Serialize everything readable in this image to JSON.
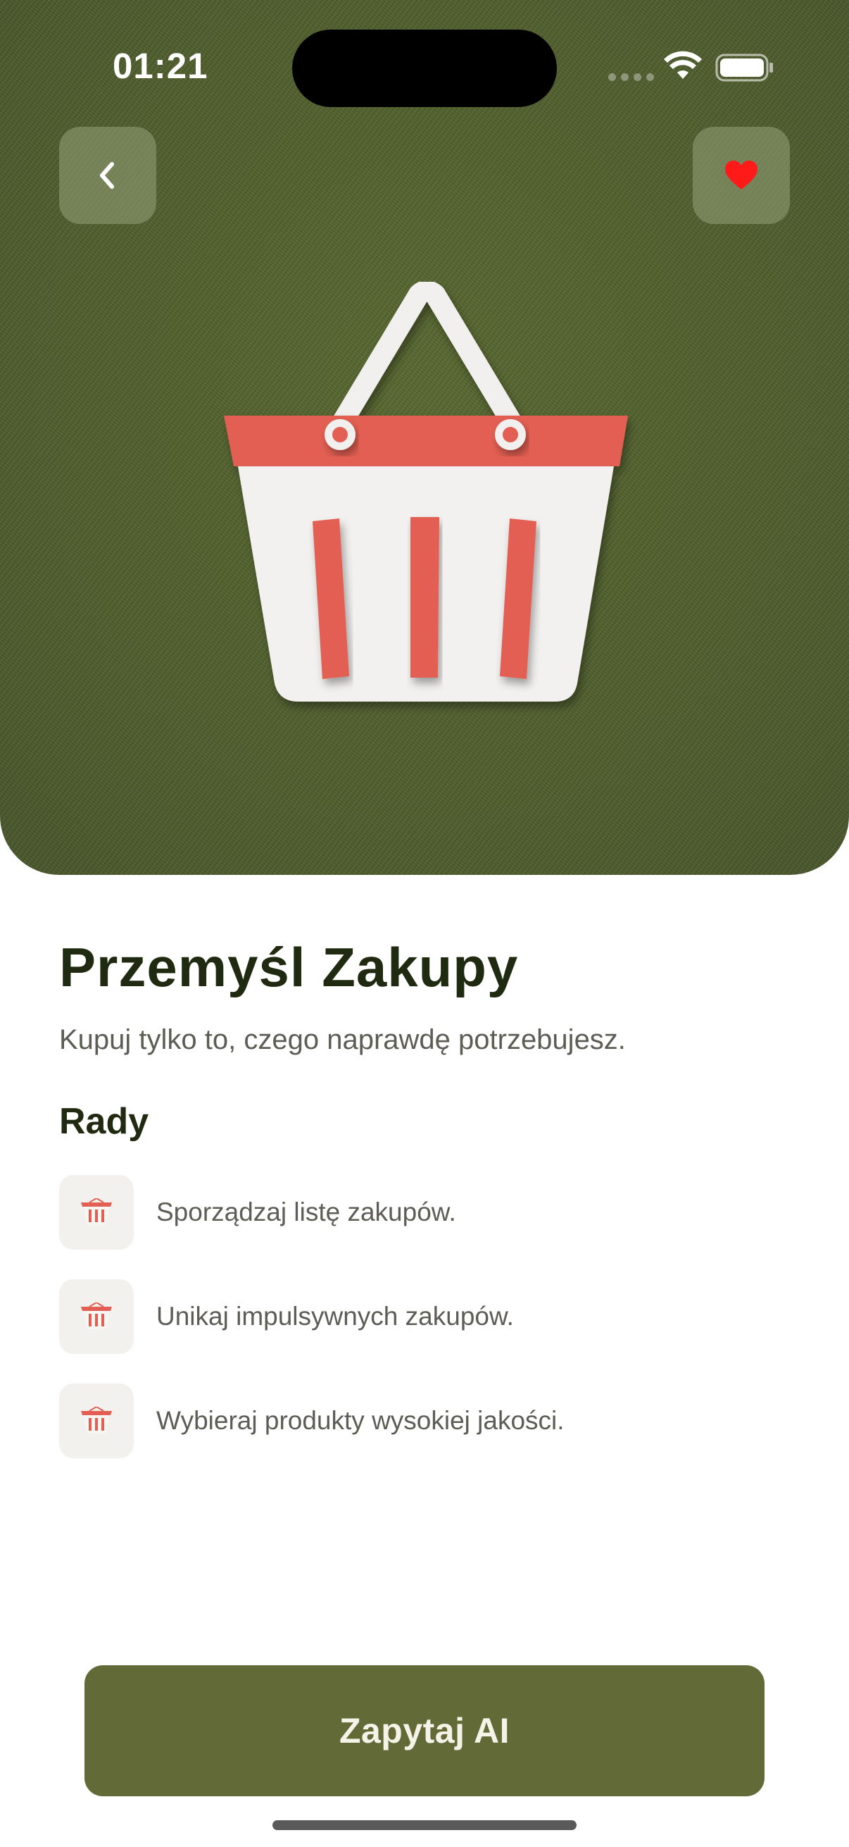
{
  "status_bar": {
    "time": "01:21"
  },
  "hero": {
    "background_color": "#4f5e2e",
    "illustration": "shopping-basket-icon"
  },
  "header": {
    "back_icon": "chevron-left-icon",
    "favorite_icon": "heart-icon",
    "favorite_color": "#ff1a1a"
  },
  "content": {
    "title": "Przemyśl Zakupy",
    "subtitle": "Kupuj tylko to, czego naprawdę potrzebujesz.",
    "section_title": "Rady",
    "tips": [
      {
        "icon": "basket-icon",
        "text": "Sporządzaj listę zakupów."
      },
      {
        "icon": "basket-icon",
        "text": "Unikaj impulsywnych zakupów."
      },
      {
        "icon": "basket-icon",
        "text": "Wybieraj produkty wysokiej jakości."
      }
    ]
  },
  "cta": {
    "label": "Zapytaj AI",
    "color": "#626b37"
  }
}
